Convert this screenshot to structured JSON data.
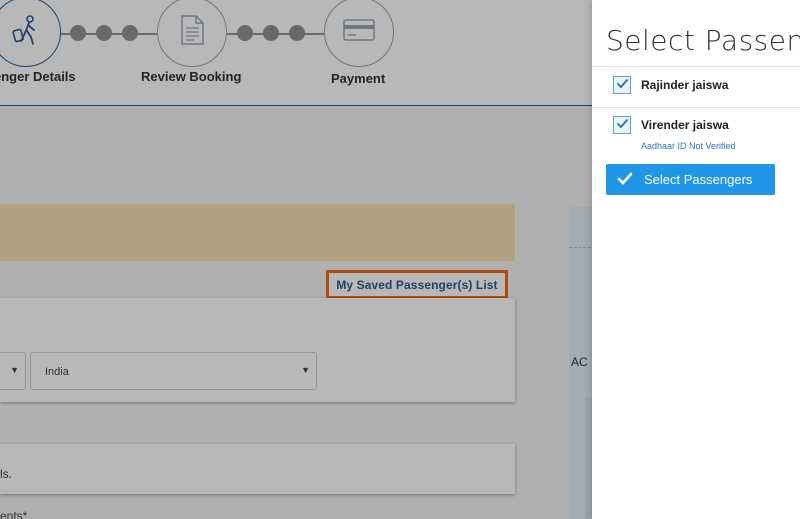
{
  "stepper": {
    "steps": [
      {
        "label": "enger Details"
      },
      {
        "label": "Review Booking"
      },
      {
        "label": "Payment"
      }
    ]
  },
  "booking": {
    "saved_list_link": "My Saved Passenger(s) List",
    "country_select_value": "India",
    "side_label": "AC",
    "text_fragment_1": "ls.",
    "text_fragment_2": "ents*."
  },
  "panel": {
    "title": "Select Passengers",
    "passengers": [
      {
        "name": "Rajinder jaiswa",
        "checked": true,
        "note": ""
      },
      {
        "name": "Virender jaiswa",
        "checked": true,
        "note": "Aadhaar ID Not Verified"
      }
    ],
    "select_button": "Select Passengers"
  },
  "colors": {
    "accent": "#2196e9",
    "highlight": "#f06a12",
    "link": "#2a5d8f",
    "note": "#2a76c6"
  },
  "icons": [
    "traveller-icon",
    "document-icon",
    "credit-card-icon",
    "checkbox-checked-icon",
    "check-icon",
    "dropdown-arrow-icon"
  ]
}
